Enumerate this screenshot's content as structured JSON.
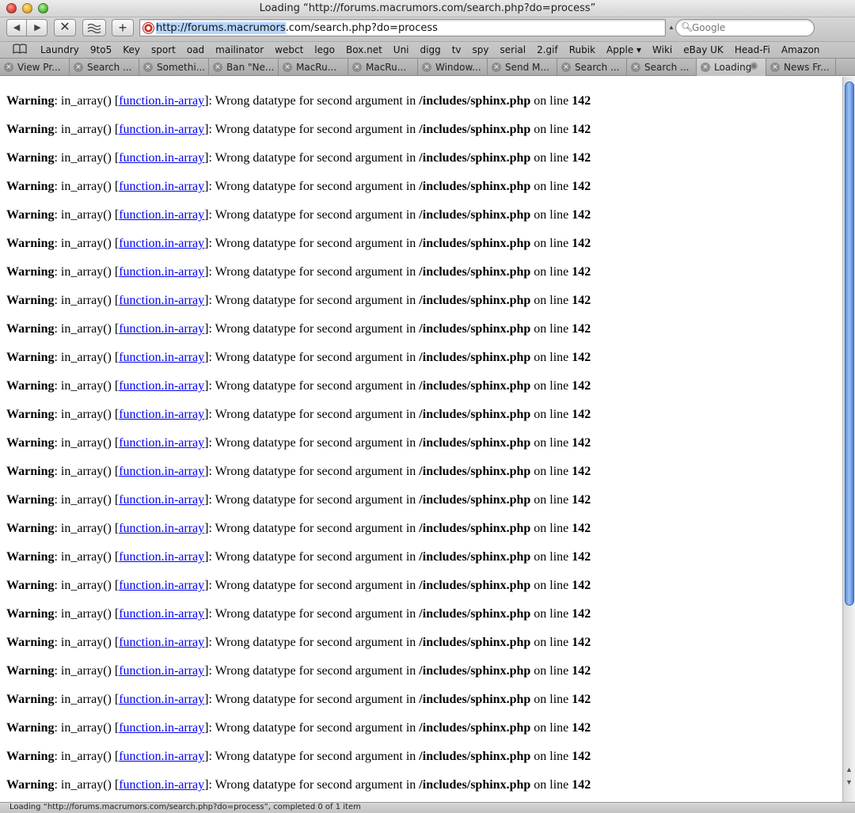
{
  "window": {
    "title": "Loading “http://forums.macrumors.com/search.php?do=process”"
  },
  "toolbar": {
    "back_glyph": "◀",
    "forward_glyph": "▶",
    "stop_glyph": "✕",
    "new_tab_glyph": "+",
    "url_selected_part": "http://forums.macrumors",
    "url_rest": ".com/search.php?do=process",
    "search_placeholder": "Google"
  },
  "bookmarks": [
    "Laundry",
    "9to5",
    "Key",
    "sport",
    "oad",
    "mailinator",
    "webct",
    "lego",
    "Box.net",
    "Uni",
    "digg",
    "tv",
    "spy",
    "serial",
    "2.gif",
    "Rubik",
    "Apple ▾",
    "Wiki",
    "eBay UK",
    "Head-Fi",
    "Amazon"
  ],
  "tabs": [
    {
      "label": "View Pr..."
    },
    {
      "label": "Search ..."
    },
    {
      "label": "Somethi..."
    },
    {
      "label": "Ban \"Ne..."
    },
    {
      "label": "MacRu..."
    },
    {
      "label": "MacRu..."
    },
    {
      "label": "Window..."
    },
    {
      "label": "Send M..."
    },
    {
      "label": "Search ..."
    },
    {
      "label": "Search ..."
    },
    {
      "label": "Loading"
    },
    {
      "label": "News Fr..."
    }
  ],
  "active_tab_index": 10,
  "warning": {
    "label": "Warning",
    "func_text": ": in_array() [",
    "link_text": "function.in-array",
    "message": "]: Wrong datatype for second argument in ",
    "file": "/includes/sphinx.php",
    "on_line": " on line ",
    "line": "142"
  },
  "warning_count": 25,
  "status": {
    "text": "Loading “http://forums.macrumors.com/search.php?do=process”, completed 0 of 1 item"
  },
  "colors": {
    "link": "#0000ee",
    "selection": "#b5d5ff",
    "scroll_thumb": "#5b8fe0"
  }
}
